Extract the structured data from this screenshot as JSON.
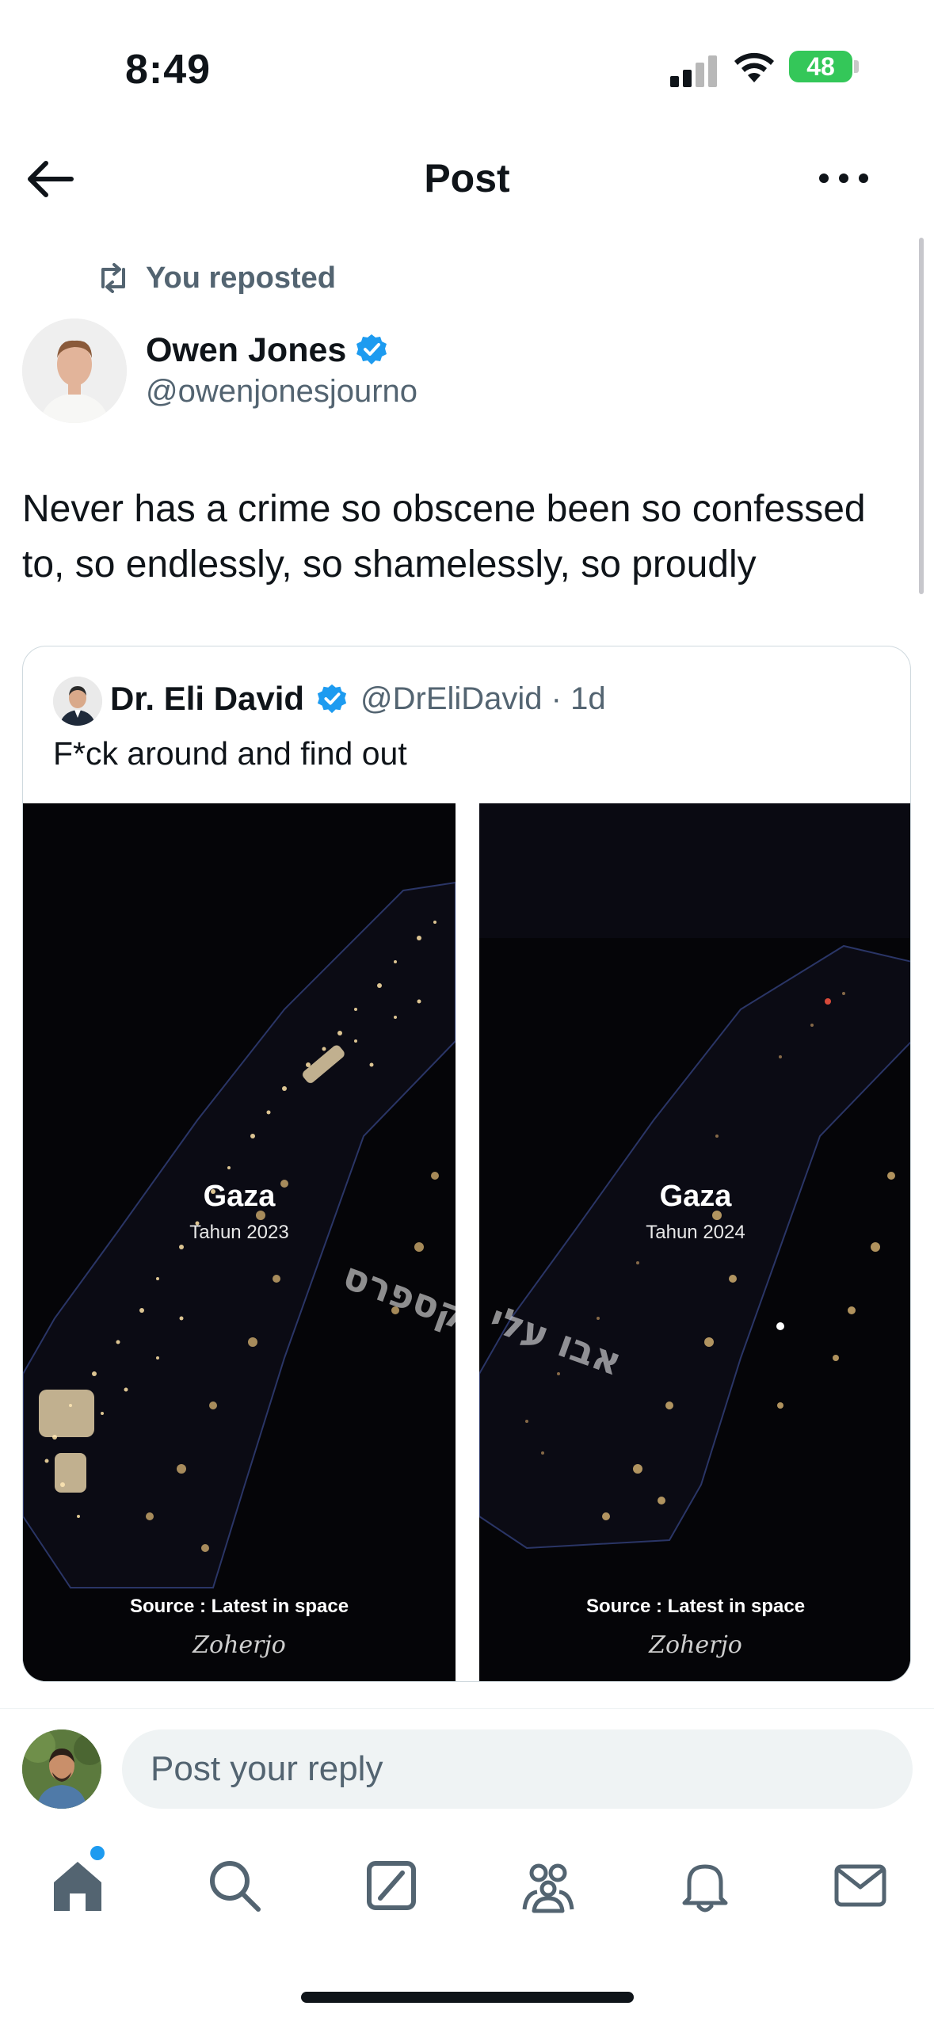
{
  "status_bar": {
    "time": "8:49",
    "battery": "48"
  },
  "header": {
    "title": "Post"
  },
  "post": {
    "repost_label": "You reposted",
    "author_name": "Owen Jones",
    "author_handle": "@owenjonesjourno",
    "text": "Never has a crime so obscene been so confessed to, so endlessly, so shamelessly, so proudly"
  },
  "quoted": {
    "author_name": "Dr. Eli David",
    "author_handle": "@DrEliDavid · 1d",
    "text": "F*ck around and find out",
    "images": [
      {
        "title": "Gaza",
        "subtitle": "Tahun 2023",
        "source": "Source : Latest in space",
        "signature": "Zoherjo",
        "watermark": "אקספרס"
      },
      {
        "title": "Gaza",
        "subtitle": "Tahun 2024",
        "source": "Source : Latest in space",
        "signature": "Zoherjo",
        "watermark": "אבו עלי"
      }
    ]
  },
  "reply": {
    "placeholder": "Post your reply"
  },
  "tabs": [
    "home-icon",
    "search-icon",
    "grok-icon",
    "communities-icon",
    "notifications-icon",
    "messages-icon"
  ],
  "colors": {
    "accent": "#1d9bf0",
    "muted": "#536471",
    "text": "#0f1419",
    "battery": "#34c759"
  }
}
